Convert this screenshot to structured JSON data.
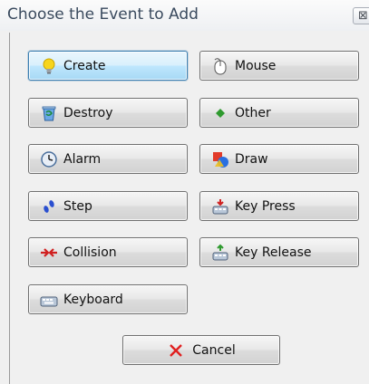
{
  "window": {
    "title": "Choose the Event to Add",
    "close_glyph": "⊠"
  },
  "buttons": {
    "create": "Create",
    "mouse": "Mouse",
    "destroy": "Destroy",
    "other": "Other",
    "alarm": "Alarm",
    "draw": "Draw",
    "step": "Step",
    "key_press": "Key Press",
    "collision": "Collision",
    "key_release": "Key Release",
    "keyboard": "Keyboard",
    "cancel": "Cancel"
  },
  "icons": {
    "create": "lightbulb-icon",
    "mouse": "mouse-icon",
    "destroy": "trash-bin-icon",
    "other": "diamond-icon",
    "alarm": "clock-icon",
    "draw": "shapes-icon",
    "step": "footsteps-icon",
    "key_press": "keyboard-press-icon",
    "collision": "collision-arrows-icon",
    "key_release": "keyboard-release-icon",
    "keyboard": "keyboard-icon",
    "cancel": "red-x-icon"
  },
  "colors": {
    "focus_border": "#3c7fb1",
    "title_text": "#3a4a5e",
    "cancel_x": "#e02020",
    "other_diamond": "#2f9a2f"
  }
}
